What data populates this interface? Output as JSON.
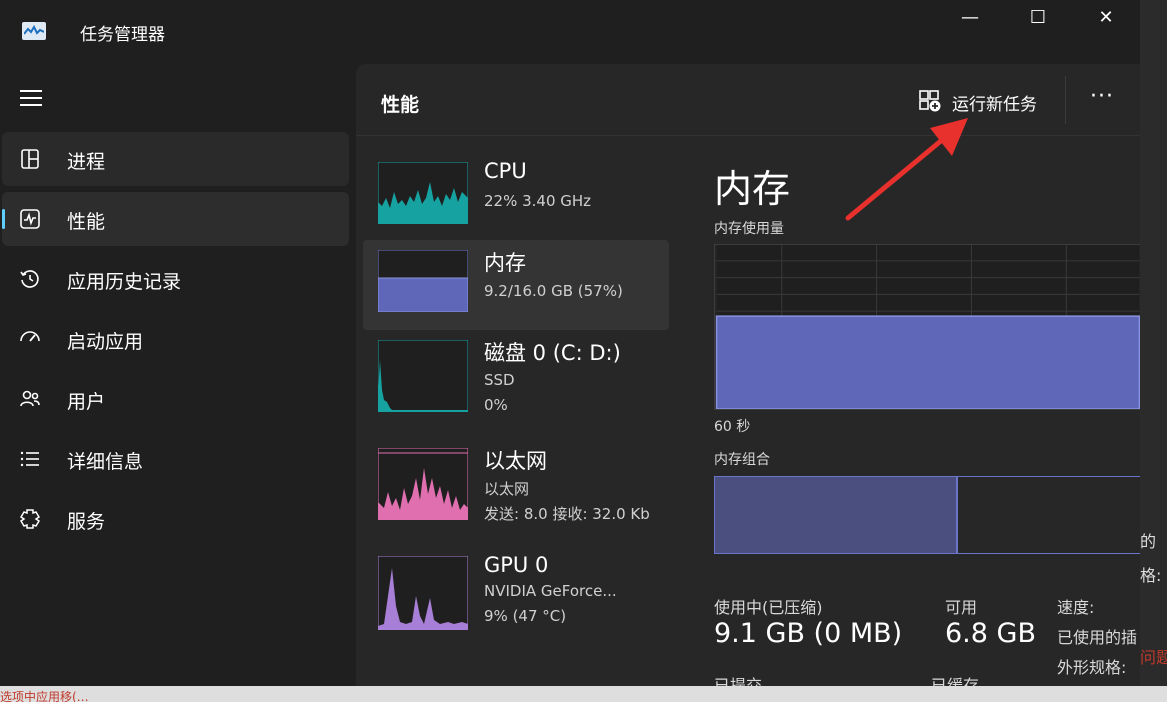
{
  "window": {
    "title": "任务管理器",
    "minimize": "—",
    "maximize": "☐",
    "close": "✕"
  },
  "nav": {
    "items": [
      {
        "label": "进程",
        "icon": "processes-icon"
      },
      {
        "label": "性能",
        "icon": "performance-icon"
      },
      {
        "label": "应用历史记录",
        "icon": "history-icon"
      },
      {
        "label": "启动应用",
        "icon": "startup-icon"
      },
      {
        "label": "用户",
        "icon": "users-icon"
      },
      {
        "label": "详细信息",
        "icon": "details-icon"
      },
      {
        "label": "服务",
        "icon": "services-icon"
      }
    ]
  },
  "header": {
    "title": "性能",
    "run_new_task": "运行新任务",
    "more": "···"
  },
  "devices": [
    {
      "name": "CPU",
      "line1": "22% 3.40 GHz",
      "line2": ""
    },
    {
      "name": "内存",
      "line1": "9.2/16.0 GB (57%)",
      "line2": ""
    },
    {
      "name": "磁盘 0 (C: D:)",
      "line1": "SSD",
      "line2": "0%"
    },
    {
      "name": "以太网",
      "line1": "以太网",
      "line2": "发送: 8.0 接收: 32.0 Kb"
    },
    {
      "name": "GPU 0",
      "line1": "NVIDIA GeForce...",
      "line2": "9% (47 °C)"
    }
  ],
  "detail": {
    "title": "内存",
    "usage_label": "内存使用量",
    "time_label": "60 秒",
    "composition_label": "内存组合",
    "memory_used_fraction": 0.57,
    "stats": {
      "in_use_label": "使用中(已压缩)",
      "in_use_value": "9.1 GB (0 MB)",
      "available_label": "可用",
      "available_value": "6.8 GB",
      "committed_label": "已提交",
      "cached_label": "已缓存",
      "speed_label": "速度:",
      "slots_label": "已使用的插",
      "form_factor_label": "外形规格:"
    }
  },
  "colors": {
    "accent": "#60cdff",
    "memory": "#6a74c8",
    "cpu": "#17a2a2",
    "ethernet": "#e06fb0",
    "gpu": "#a77fd6",
    "annotation": "#e8302d"
  },
  "background": {
    "right_lines": [
      "的",
      "格:",
      "问题"
    ],
    "bottom_text": "选项中应用移(…"
  }
}
